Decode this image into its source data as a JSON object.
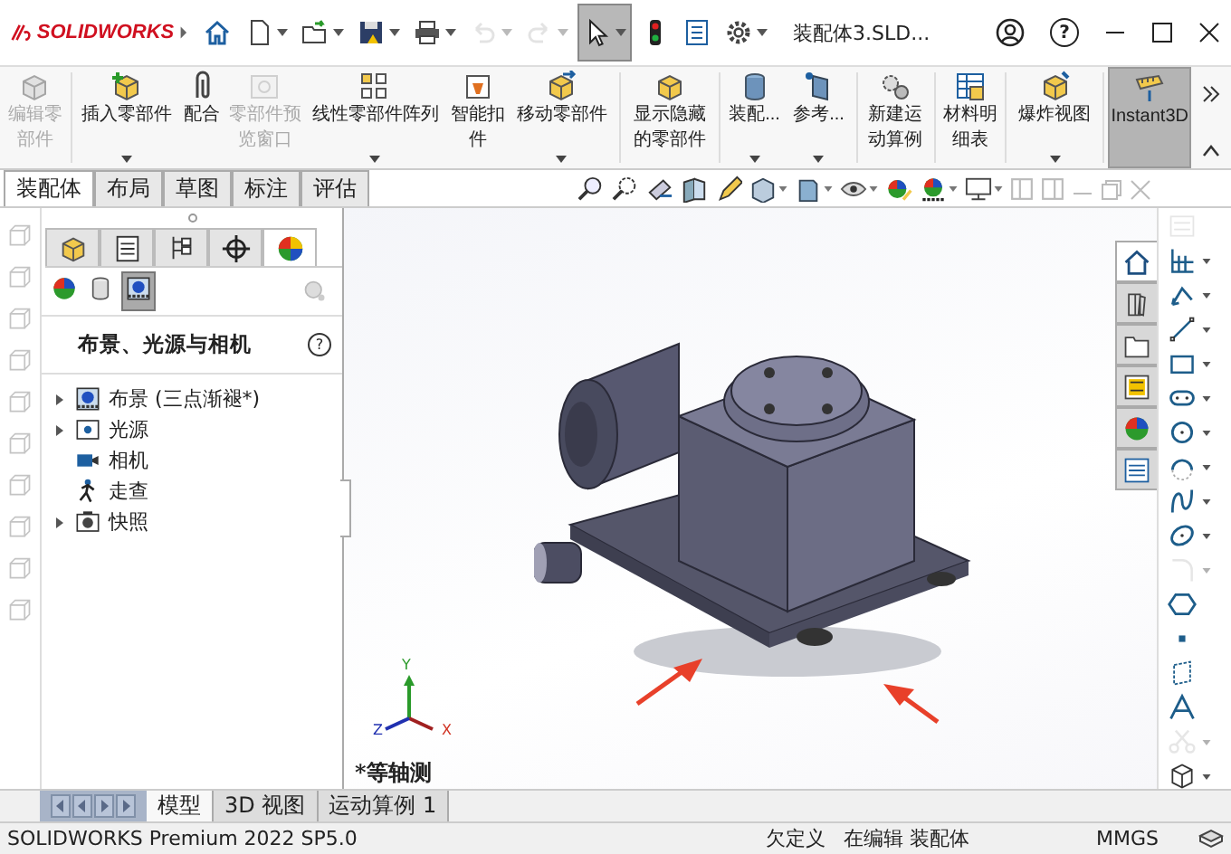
{
  "title_bar": {
    "logo_text": "SOLIDWORKS",
    "document_title": "装配体3.SLD...",
    "help_glyph": "?"
  },
  "quick_access": [
    {
      "kind": "home",
      "selected": false,
      "disabled": false,
      "dropdown": false
    },
    {
      "kind": "new",
      "selected": false,
      "disabled": false,
      "dropdown": true
    },
    {
      "kind": "open",
      "selected": false,
      "disabled": false,
      "dropdown": true
    },
    {
      "kind": "save",
      "selected": false,
      "disabled": false,
      "dropdown": true
    },
    {
      "kind": "print",
      "selected": false,
      "disabled": false,
      "dropdown": true
    },
    {
      "kind": "undo",
      "selected": false,
      "disabled": true,
      "dropdown": true
    },
    {
      "kind": "redo",
      "selected": false,
      "disabled": true,
      "dropdown": true
    },
    {
      "kind": "select",
      "selected": true,
      "disabled": false,
      "dropdown": true
    },
    {
      "kind": "rebuild",
      "selected": false,
      "disabled": false,
      "dropdown": false
    },
    {
      "kind": "file-properties",
      "selected": false,
      "disabled": false,
      "dropdown": false
    },
    {
      "kind": "options",
      "selected": false,
      "disabled": false,
      "dropdown": true
    }
  ],
  "ribbon": [
    {
      "kind": "edit-part",
      "label": "编辑零部件",
      "disabled": true,
      "dropdown": false,
      "selected": false
    },
    {
      "kind": "insert",
      "label": "插入零部件",
      "disabled": false,
      "dropdown": true,
      "selected": false
    },
    {
      "kind": "mate",
      "label": "配合",
      "disabled": false,
      "dropdown": false,
      "selected": false
    },
    {
      "kind": "preview",
      "label": "零部件预览窗口",
      "disabled": true,
      "dropdown": false,
      "selected": false
    },
    {
      "kind": "pattern",
      "label": "线性零部件阵列",
      "disabled": false,
      "dropdown": true,
      "selected": false
    },
    {
      "kind": "fastener",
      "label": "智能扣件",
      "disabled": false,
      "dropdown": false,
      "selected": false
    },
    {
      "kind": "move",
      "label": "移动零部件",
      "disabled": false,
      "dropdown": true,
      "selected": false
    },
    {
      "kind": "show-hidden",
      "label": "显示隐藏的零部件",
      "disabled": false,
      "dropdown": false,
      "selected": false
    },
    {
      "kind": "assembly",
      "label": "装配...",
      "disabled": false,
      "dropdown": true,
      "selected": false
    },
    {
      "kind": "reference",
      "label": "参考...",
      "disabled": false,
      "dropdown": true,
      "selected": false
    },
    {
      "kind": "motion",
      "label": "新建运动算例",
      "disabled": false,
      "dropdown": false,
      "selected": false
    },
    {
      "kind": "bom",
      "label": "材料明细表",
      "disabled": false,
      "dropdown": false,
      "selected": false
    },
    {
      "kind": "explode",
      "label": "爆炸视图",
      "disabled": false,
      "dropdown": true,
      "selected": false
    },
    {
      "kind": "instant3d",
      "label": "Instant3D",
      "disabled": false,
      "dropdown": false,
      "selected": true
    }
  ],
  "tabs": [
    {
      "label": "装配体",
      "selected": true
    },
    {
      "label": "布局",
      "selected": false
    },
    {
      "label": "草图",
      "selected": false
    },
    {
      "label": "标注",
      "selected": false
    },
    {
      "label": "评估",
      "selected": false
    }
  ],
  "panel": {
    "tabs": [
      {
        "kind": "feature",
        "selected": false
      },
      {
        "kind": "property",
        "selected": false
      },
      {
        "kind": "config",
        "selected": false
      },
      {
        "kind": "dimxpert",
        "selected": false
      },
      {
        "kind": "display",
        "selected": true
      }
    ],
    "subtabs": [
      {
        "kind": "appearance",
        "selected": false
      },
      {
        "kind": "decal",
        "selected": false
      },
      {
        "kind": "scene",
        "selected": true
      }
    ],
    "title": "布景、光源与相机",
    "help_glyph": "?",
    "tree": [
      {
        "kind": "scene",
        "label": "布景 (三点渐褪*)",
        "expandable": true
      },
      {
        "kind": "lights",
        "label": "光源",
        "expandable": true
      },
      {
        "kind": "camera",
        "label": "相机",
        "expandable": false
      },
      {
        "kind": "walkthrough",
        "label": "走查",
        "expandable": false
      },
      {
        "kind": "snapshot",
        "label": "快照",
        "expandable": true
      }
    ]
  },
  "viewport": {
    "view_name": "*等轴测",
    "triad": {
      "x": "X",
      "y": "Y",
      "z": "Z"
    }
  },
  "task_pane": [
    {
      "kind": "home",
      "selected": true
    },
    {
      "kind": "library",
      "selected": false
    },
    {
      "kind": "explorer",
      "selected": false
    },
    {
      "kind": "palette",
      "selected": false
    },
    {
      "kind": "appearances",
      "selected": false
    },
    {
      "kind": "custom",
      "selected": false
    }
  ],
  "sketch_tools": [
    {
      "kind": "smart-dim",
      "disabled": true,
      "dropdown": false
    },
    {
      "kind": "grid",
      "disabled": false,
      "dropdown": true
    },
    {
      "kind": "dimension",
      "disabled": false,
      "dropdown": true
    },
    {
      "kind": "line",
      "disabled": false,
      "dropdown": true
    },
    {
      "kind": "rectangle",
      "disabled": false,
      "dropdown": true
    },
    {
      "kind": "slot",
      "disabled": false,
      "dropdown": true
    },
    {
      "kind": "circle",
      "disabled": false,
      "dropdown": true
    },
    {
      "kind": "arc",
      "disabled": false,
      "dropdown": true
    },
    {
      "kind": "spline",
      "disabled": false,
      "dropdown": true
    },
    {
      "kind": "ellipse",
      "disabled": false,
      "dropdown": true
    },
    {
      "kind": "fillet",
      "disabled": true,
      "dropdown": true
    },
    {
      "kind": "polygon",
      "disabled": false,
      "dropdown": false
    },
    {
      "kind": "point",
      "disabled": false,
      "dropdown": false
    },
    {
      "kind": "plane",
      "disabled": false,
      "dropdown": false
    },
    {
      "kind": "text",
      "disabled": false,
      "dropdown": false
    },
    {
      "kind": "trim",
      "disabled": true,
      "dropdown": true
    },
    {
      "kind": "cube",
      "disabled": false,
      "dropdown": true
    }
  ],
  "bottom_tabs": [
    {
      "label": "模型",
      "selected": true
    },
    {
      "label": "3D 视图",
      "selected": false
    },
    {
      "label": "运动算例 1",
      "selected": false
    }
  ],
  "status_bar": {
    "product": "SOLIDWORKS Premium 2022 SP5.0",
    "state": "欠定义",
    "mode": "在编辑 装配体",
    "units": "MMGS"
  }
}
